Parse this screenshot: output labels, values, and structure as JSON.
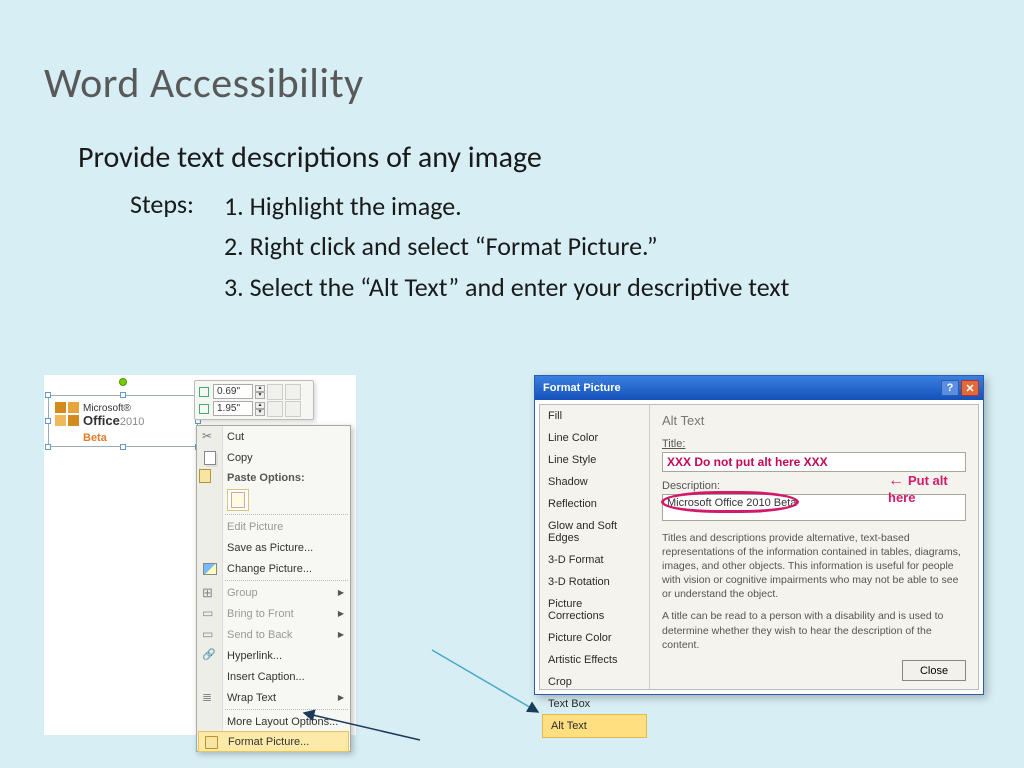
{
  "title": "Word Accessibility",
  "subtitle": "Provide text descriptions of any image",
  "steps_label": "Steps:",
  "steps": [
    "1. Highlight the image.",
    "2. Right click and select “Format Picture.”",
    "3. Select the “Alt Text”  and enter your descriptive text"
  ],
  "selected_image": {
    "brand_small": "Microsoft®",
    "brand_big": "Office",
    "brand_year": "2010",
    "beta": "Beta"
  },
  "mini_toolbar": {
    "height": "0.69\"",
    "width": "1.95\""
  },
  "ctx_menu": {
    "cut": "Cut",
    "copy": "Copy",
    "paste_heading": "Paste Options:",
    "edit_picture": "Edit Picture",
    "save_as_picture": "Save as Picture...",
    "change_picture": "Change Picture...",
    "group": "Group",
    "bring_front": "Bring to Front",
    "send_back": "Send to Back",
    "hyperlink": "Hyperlink...",
    "insert_caption": "Insert Caption...",
    "wrap_text": "Wrap Text",
    "more_layout": "More Layout Options...",
    "format_picture": "Format Picture..."
  },
  "dlg": {
    "title": "Format Picture",
    "nav": [
      "Fill",
      "Line Color",
      "Line Style",
      "Shadow",
      "Reflection",
      "Glow and Soft Edges",
      "3-D Format",
      "3-D Rotation",
      "Picture Corrections",
      "Picture Color",
      "Artistic Effects",
      "Crop",
      "Text Box",
      "Alt Text"
    ],
    "pane_heading": "Alt Text",
    "title_label": "Title:",
    "title_value": "XXX Do not put alt here XXX",
    "desc_label": "Description:",
    "desc_value": "Microsoft Office 2010 Beta",
    "annotation": "Put alt here",
    "help1": "Titles and descriptions provide alternative, text-based representations of the information contained in tables, diagrams, images, and other objects. This information is useful for people with vision or cognitive impairments who may not be able to see or understand the object.",
    "help2": "A title can be read to a person with a disability and is used to determine whether they wish to hear the description of the content.",
    "close": "Close"
  }
}
